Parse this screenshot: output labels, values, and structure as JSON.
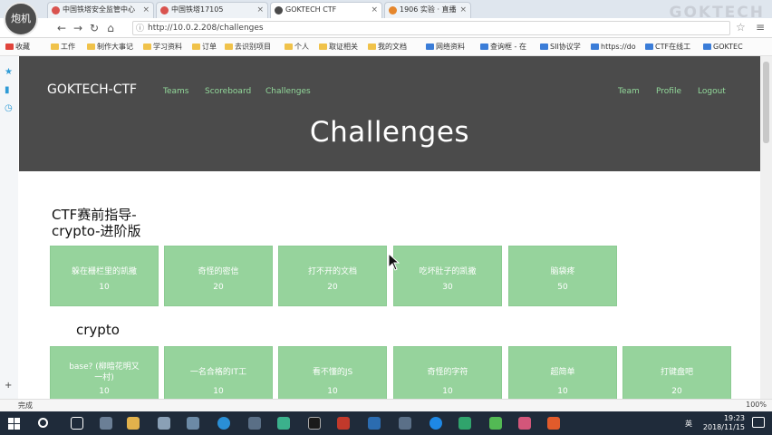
{
  "browser": {
    "avatar_text": "炮机",
    "tabs": [
      {
        "title": "中国铁塔安全监管中心"
      },
      {
        "title": "中国铁塔17105"
      },
      {
        "title": "GOKTECH CTF"
      },
      {
        "title": "1906 实验 · 直播"
      }
    ],
    "watermark": "GOKTECH",
    "url": "http://10.0.2.208/challenges",
    "bookmarks": [
      "收藏",
      "工作",
      "制作大事记",
      "学习资料",
      "订单",
      "去识别项目",
      "个人",
      "取证相关",
      "我的文档",
      "网络资料",
      "查询框 - 在",
      "SII协议学",
      "https://do",
      "CTF在线工",
      "GOKTEC"
    ]
  },
  "ctf": {
    "brand": "GOKTECH-CTF",
    "nav_left": [
      "Teams",
      "Scoreboard",
      "Challenges"
    ],
    "nav_right": [
      "Team",
      "Profile",
      "Logout"
    ],
    "jumbotron_title": "Challenges"
  },
  "categories": [
    {
      "title_line1": "CTF赛前指导-",
      "title_line2": "crypto-进阶版",
      "challenges": [
        {
          "name": "躲在栅栏里的凯撒",
          "value": "10"
        },
        {
          "name": "奇怪的密信",
          "value": "20"
        },
        {
          "name": "打不开的文档",
          "value": "20"
        },
        {
          "name": "吃坏肚子的凯撒",
          "value": "30"
        },
        {
          "name": "脑袋疼",
          "value": "50"
        }
      ]
    },
    {
      "title_line1": "crypto",
      "challenges": [
        {
          "name": "base? (柳暗花明又一村)",
          "value": "10"
        },
        {
          "name": "一名合格的IT工",
          "value": "10"
        },
        {
          "name": "看不懂的JS",
          "value": "10"
        },
        {
          "name": "奇怪的字符",
          "value": "10"
        },
        {
          "name": "超简单",
          "value": "10"
        },
        {
          "name": "打键盘吧",
          "value": "20"
        }
      ]
    }
  ],
  "statusbar": {
    "left": "完成",
    "zoom": "100%"
  },
  "taskbar": {
    "ime": "英",
    "time": "19:23",
    "date": "2018/11/15"
  },
  "colors": {
    "header_bg": "#4b4b4b",
    "card_bg": "#96d39c",
    "nav_link": "#92d89a"
  }
}
